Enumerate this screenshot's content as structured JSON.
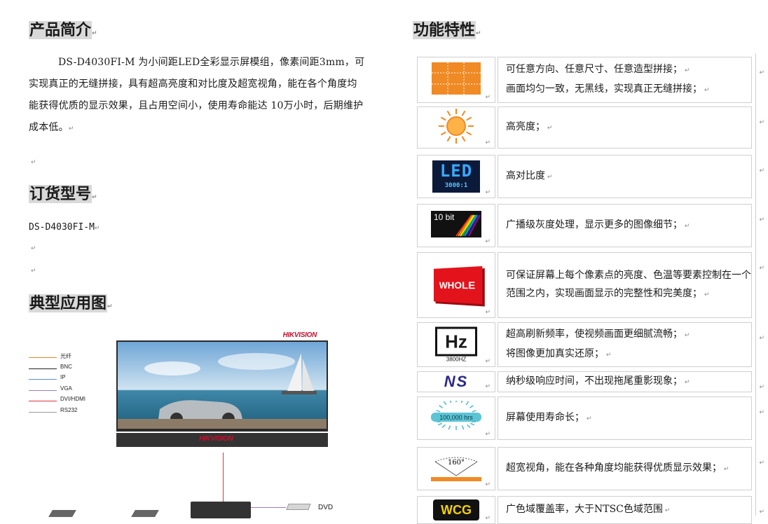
{
  "left": {
    "h_intro": "产品简介",
    "intro_text": "DS-D4030FI-M 为小间距LED全彩显示屏模组，像素间距3mm，可实现真正的无缝拼接，具有超高亮度和对比度及超宽视角，能在各个角度均能获得优质的显示效果，且占用空间小，使用寿命能达 10万小时，后期维护成本低。",
    "h_order": "订货型号",
    "model": "DS-D4030FI-M",
    "h_app": "典型应用图"
  },
  "diagram": {
    "brand_top": "HIKVISION",
    "brand_bottom": "HIKVISION",
    "dvd_label": "DVD",
    "legend": [
      {
        "label": "光纤",
        "color": "#e8882a"
      },
      {
        "label": "BNC",
        "color": "#222222"
      },
      {
        "label": "IP",
        "color": "#5b8fd6"
      },
      {
        "label": "VGA",
        "color": "#9a7cc4"
      },
      {
        "label": "DVI/HDMI",
        "color": "#e0323b"
      },
      {
        "label": "RS232",
        "color": "#999999"
      }
    ]
  },
  "right": {
    "h_features": "功能特性",
    "features": [
      {
        "icon": "seamless-grid-icon",
        "lines": [
          "可任意方向、任意尺寸、任意造型拼接；",
          "画面均匀一致，无黑线，实现真正无缝拼接；"
        ]
      },
      {
        "icon": "sun-brightness-icon",
        "lines": [
          "高亮度；"
        ]
      },
      {
        "icon": "led-contrast-icon",
        "lines": [
          "高对比度"
        ],
        "icon_text": "LED",
        "icon_sub": "3000:1"
      },
      {
        "icon": "10bit-gray-icon",
        "lines": [
          "广播级灰度处理，显示更多的图像细节；"
        ],
        "icon_text": "10 bit"
      },
      {
        "icon": "whole-icon",
        "lines": [
          "可保证屏幕上每个像素点的亮度、色温等要素控制在一个范围之内，实现画面显示的完整性和完美度；"
        ],
        "icon_text": "WHOLE"
      },
      {
        "icon": "hz-refresh-icon",
        "lines": [
          "超高刷新频率，使视频画面更细腻流畅；",
          "将图像更加真实还原；"
        ],
        "icon_text": "Hz",
        "icon_sub": "3800HZ"
      },
      {
        "icon": "ns-response-icon",
        "lines": [
          "纳秒级响应时间，不出现拖尾重影现象；"
        ],
        "icon_text": "NS"
      },
      {
        "icon": "lifespan-icon",
        "lines": [
          "屏幕使用寿命长；"
        ],
        "icon_text": "100,000 hrs"
      },
      {
        "icon": "viewing-angle-icon",
        "lines": [
          "超宽视角，能在各种角度均能获得优质显示效果；"
        ],
        "icon_text": "160°"
      },
      {
        "icon": "wcg-icon",
        "lines": [
          "广色域覆盖率，大于NTSC色域范围"
        ],
        "icon_text": "WCG"
      }
    ]
  },
  "colors": {
    "heading_bg": "#d9d9d9",
    "brand_red": "#c8102e",
    "orange": "#f08a24"
  }
}
